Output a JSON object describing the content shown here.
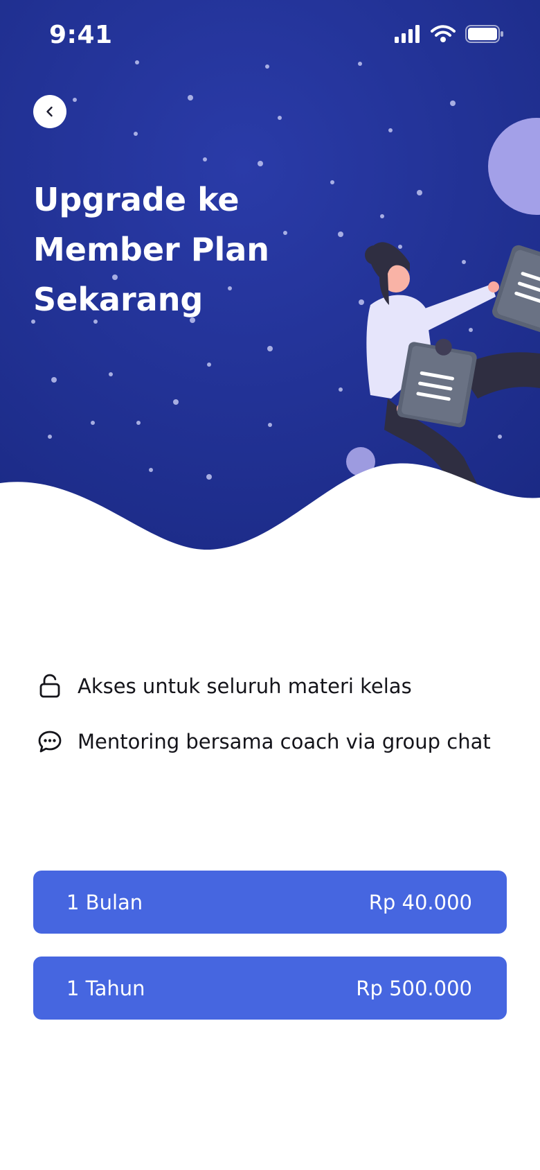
{
  "status_bar": {
    "time": "9:41",
    "icons": [
      "signal-icon",
      "wifi-icon",
      "battery-icon"
    ]
  },
  "hero": {
    "title_lines": [
      "Upgrade ke",
      "Member Plan",
      "Sekarang"
    ],
    "back_icon": "chevron-left-icon",
    "colors": {
      "background": "#1f2f8f",
      "accent": "#a3a0e8"
    }
  },
  "features": [
    {
      "icon": "unlock-icon",
      "label": "Akses untuk seluruh materi kelas"
    },
    {
      "icon": "chat-bubble-icon",
      "label": "Mentoring bersama coach via group chat"
    }
  ],
  "plans": [
    {
      "duration": "1 Bulan",
      "price": "Rp 40.000"
    },
    {
      "duration": "1 Tahun",
      "price": "Rp 500.000"
    }
  ],
  "colors": {
    "primary": "#4666e0",
    "text": "#14141a"
  }
}
